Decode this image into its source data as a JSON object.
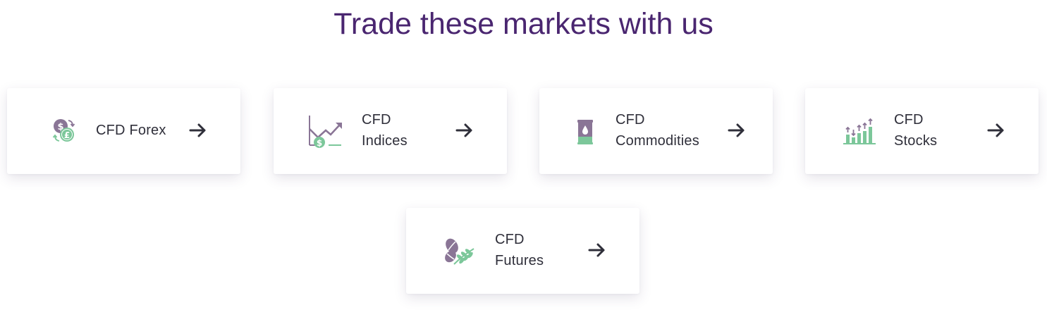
{
  "heading": "Trade these markets with us",
  "colors": {
    "heading": "#4a2670",
    "icon_purple": "#8a7596",
    "icon_green": "#7cc79a",
    "text": "#2f2f3a"
  },
  "markets": [
    {
      "line1": "CFD Forex",
      "line2": "",
      "icon": "currency-exchange-icon"
    },
    {
      "line1": "CFD",
      "line2": "Indices",
      "icon": "index-chart-icon"
    },
    {
      "line1": "CFD",
      "line2": "Commodities",
      "icon": "oil-barrel-icon"
    },
    {
      "line1": "CFD",
      "line2": "Stocks",
      "icon": "stock-bars-icon"
    },
    {
      "line1": "CFD",
      "line2": "Futures",
      "icon": "grain-wheat-icon"
    }
  ]
}
